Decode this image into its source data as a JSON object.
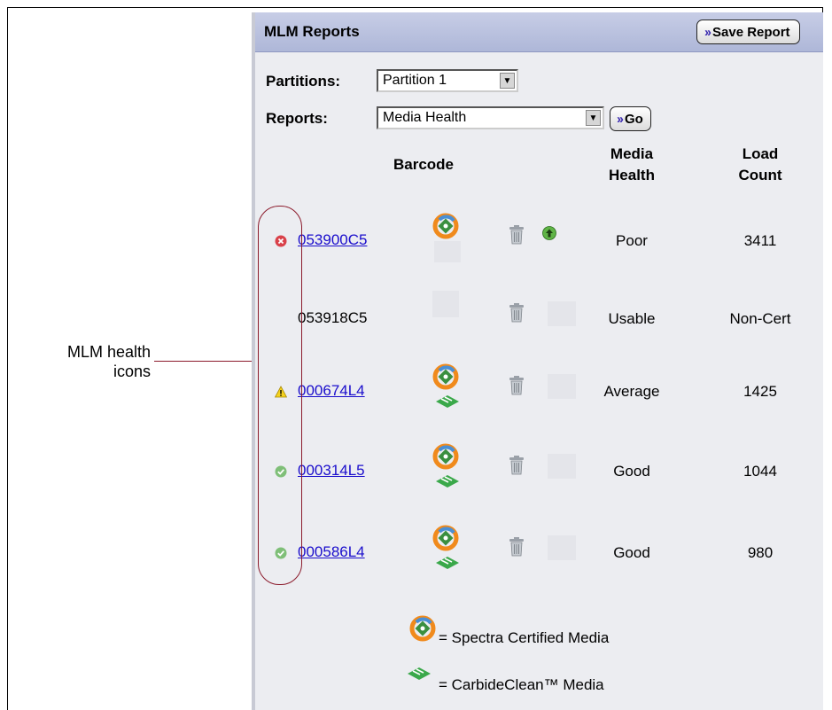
{
  "callout": {
    "label_line1": "MLM health",
    "label_line2": "icons"
  },
  "panel": {
    "title": "MLM Reports",
    "save_button": "Save Report",
    "partitions_label": "Partitions:",
    "partition_selected": "Partition 1",
    "reports_label": "Reports:",
    "report_selected": "Media Health",
    "go_button": "Go"
  },
  "table": {
    "headers": {
      "barcode": "Barcode",
      "health_line1": "Media",
      "health_line2": "Health",
      "load_line1": "Load",
      "load_line2": "Count"
    },
    "rows": [
      {
        "status": "error",
        "barcode": "053900C5",
        "linked": true,
        "certified": true,
        "carbide": false,
        "upgrade": true,
        "health": "Poor",
        "load": "3411"
      },
      {
        "status": "none",
        "barcode": "053918C5",
        "linked": false,
        "certified": false,
        "carbide": false,
        "upgrade": false,
        "health": "Usable",
        "load": "Non-Cert"
      },
      {
        "status": "warning",
        "barcode": "000674L4",
        "linked": true,
        "certified": true,
        "carbide": true,
        "upgrade": false,
        "health": "Average",
        "load": "1425"
      },
      {
        "status": "good",
        "barcode": "000314L5",
        "linked": true,
        "certified": true,
        "carbide": true,
        "upgrade": false,
        "health": "Good",
        "load": "1044"
      },
      {
        "status": "good",
        "barcode": "000586L4",
        "linked": true,
        "certified": true,
        "carbide": true,
        "upgrade": false,
        "health": "Good",
        "load": "980"
      }
    ]
  },
  "legend": {
    "certified": "= Spectra Certified Media",
    "carbide": "= CarbideClean™ Media"
  },
  "colors": {
    "link": "#1a0dcc",
    "callout": "#8b1a2b",
    "header": "#aeb7d8"
  }
}
